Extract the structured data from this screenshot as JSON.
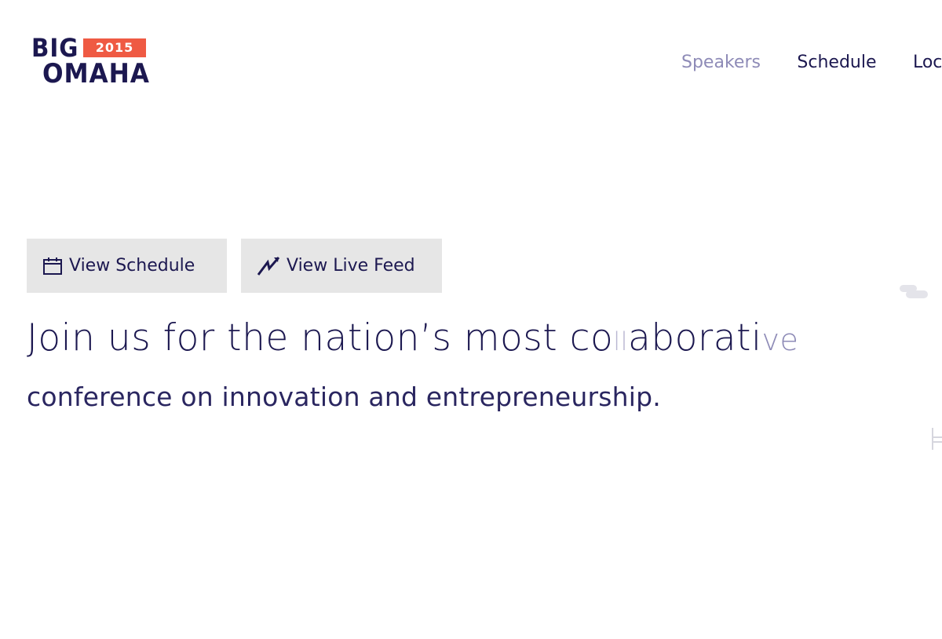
{
  "logo": {
    "big": "BIG",
    "year": "2015",
    "omaha": "OMAHA"
  },
  "nav": {
    "items": [
      "Speakers",
      "Schedule",
      "Loca"
    ]
  },
  "buttons": {
    "schedule": "View Schedule",
    "live_feed": "View Live Feed"
  },
  "hero": {
    "line1_a": "Join us for the nation’s most co",
    "line1_l1": "l",
    "line1_l2": "l",
    "line1_b": "aborati",
    "line1_v": "v",
    "line1_c": "e",
    "line2": "conference on innovation and entrepreneurship."
  },
  "icons": {
    "schedule": "calendar-icon",
    "live_feed": "lightning-icon"
  },
  "colors": {
    "navy": "#1c1850",
    "accent": "#ef5a43",
    "nav_active": "#8e8bb7",
    "button_bg": "#e6e6e6"
  }
}
